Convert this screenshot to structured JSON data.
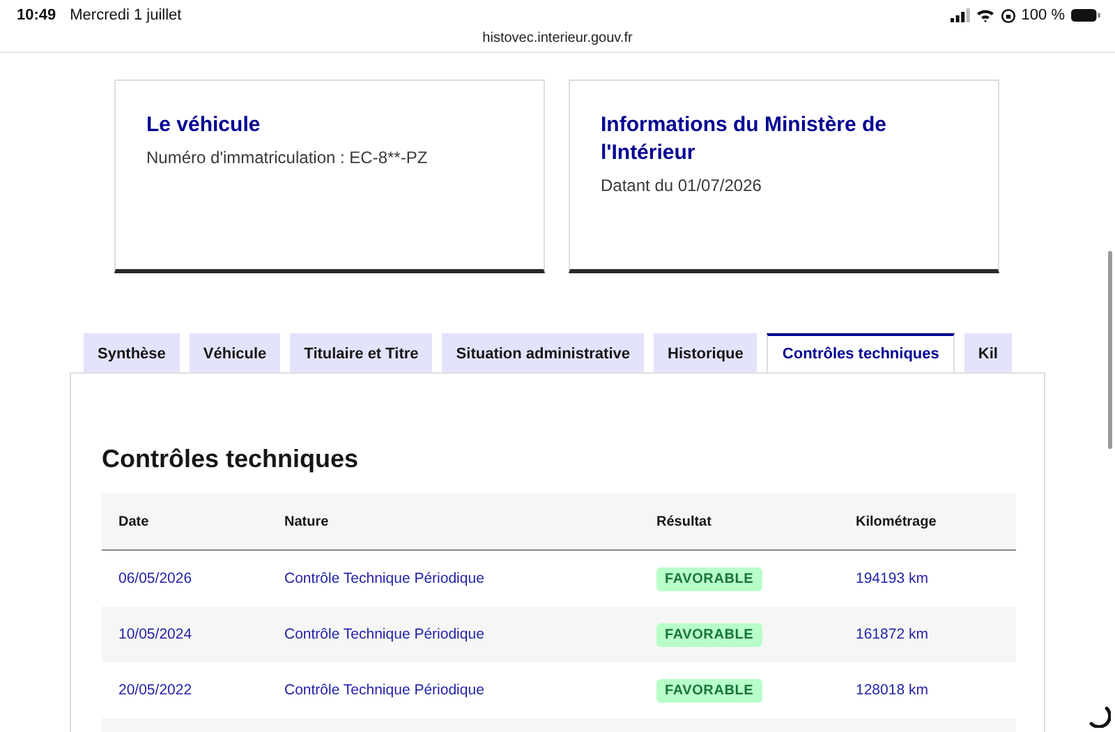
{
  "status_bar": {
    "time": "10:49",
    "date": "Mercredi 1 juillet",
    "battery": "100 %",
    "url": "histovec.interieur.gouv.fr"
  },
  "cards": [
    {
      "title": "Le véhicule",
      "text": "Numéro d'immatriculation : EC-8**-PZ"
    },
    {
      "title": "Informations du Ministère de l'Intérieur",
      "text": "Datant du 01/07/2026"
    }
  ],
  "tabs": [
    {
      "label": "Synthèse",
      "selected": false
    },
    {
      "label": "Véhicule",
      "selected": false
    },
    {
      "label": "Titulaire et Titre",
      "selected": false
    },
    {
      "label": "Situation administrative",
      "selected": false
    },
    {
      "label": "Historique",
      "selected": false
    },
    {
      "label": "Contrôles techniques",
      "selected": true
    },
    {
      "label": "Kil",
      "selected": false
    }
  ],
  "section_title": "Contrôles techniques",
  "table": {
    "columns": [
      "Date",
      "Nature",
      "Résultat",
      "Kilométrage"
    ],
    "rows": [
      {
        "date": "06/05/2026",
        "nature": "Contrôle Technique Périodique",
        "result": "FAVORABLE",
        "mileage": "194193 km"
      },
      {
        "date": "10/05/2024",
        "nature": "Contrôle Technique Périodique",
        "result": "FAVORABLE",
        "mileage": "161872 km"
      },
      {
        "date": "20/05/2022",
        "nature": "Contrôle Technique Périodique",
        "result": "FAVORABLE",
        "mileage": "128018 km"
      }
    ]
  }
}
